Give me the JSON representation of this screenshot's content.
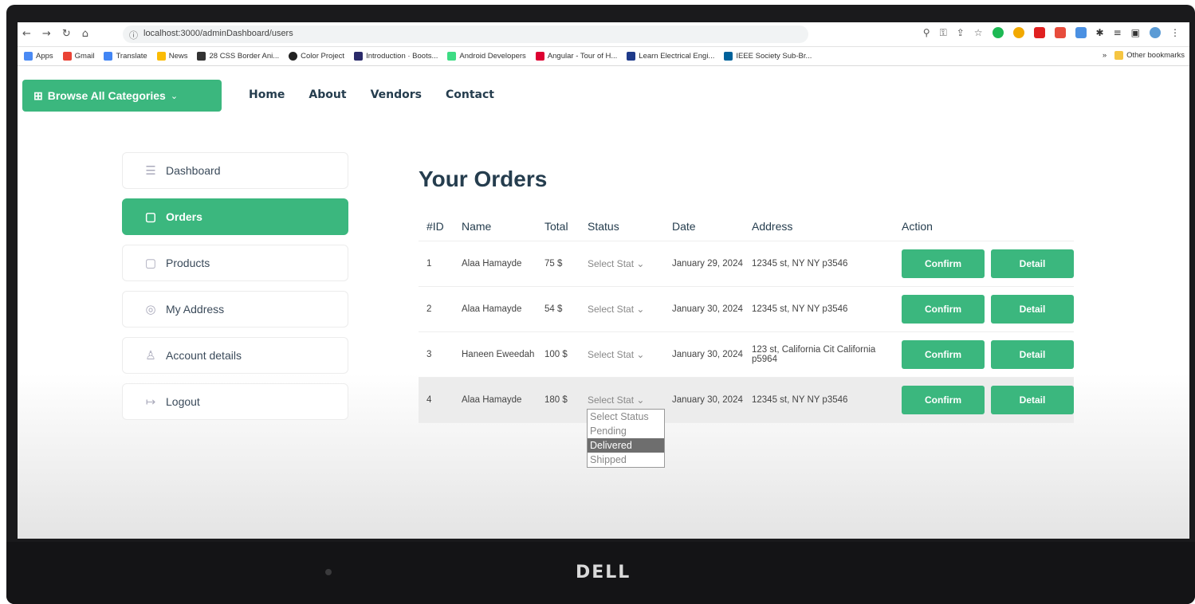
{
  "browser": {
    "url": "localhost:3000/adminDashboard/users",
    "bookmarks": [
      "Apps",
      "Gmail",
      "Translate",
      "News",
      "28 CSS Border Ani...",
      "Color Project",
      "Introduction · Boots...",
      "Android Developers",
      "Angular - Tour of H...",
      "Learn Electrical Engi...",
      "IEEE Society Sub-Br..."
    ],
    "other_bookmarks": "Other bookmarks",
    "overflow": "»"
  },
  "header": {
    "browse_label": "Browse All Categories",
    "nav": [
      "Home",
      "About",
      "Vendors",
      "Contact"
    ]
  },
  "sidebar": {
    "items": [
      {
        "label": "Dashboard",
        "icon": "sliders-icon"
      },
      {
        "label": "Orders",
        "icon": "bag-icon"
      },
      {
        "label": "Products",
        "icon": "bag-icon"
      },
      {
        "label": "My Address",
        "icon": "location-pin-icon"
      },
      {
        "label": "Account details",
        "icon": "user-icon"
      },
      {
        "label": "Logout",
        "icon": "logout-icon"
      }
    ]
  },
  "orders": {
    "title": "Your Orders",
    "columns": [
      "#ID",
      "Name",
      "Total",
      "Status",
      "Date",
      "Address",
      "Action"
    ],
    "rows": [
      {
        "id": "1",
        "name": "Alaa Hamayde",
        "total": "75 $",
        "status": "Select Stat",
        "date": "January 29, 2024",
        "address": "12345 st, NY NY p3546"
      },
      {
        "id": "2",
        "name": "Alaa Hamayde",
        "total": "54 $",
        "status": "Select Stat",
        "date": "January 30, 2024",
        "address": "12345 st, NY NY p3546"
      },
      {
        "id": "3",
        "name": "Haneen Eweedah",
        "total": "100 $",
        "status": "Select Stat",
        "date": "January 30, 2024",
        "address": "123 st, California Cit California p5964"
      },
      {
        "id": "4",
        "name": "Alaa Hamayde",
        "total": "180 $",
        "status": "Select Stat",
        "date": "January 30, 2024",
        "address": "12345 st, NY NY p3546"
      }
    ],
    "confirm_label": "Confirm",
    "detail_label": "Detail"
  },
  "status_dropdown": {
    "options": [
      "Select Status",
      "Pending",
      "Delivered",
      "Shipped"
    ],
    "highlighted": "Delivered"
  },
  "monitor_brand": "DELL",
  "colors": {
    "accent": "#3bb77e",
    "heading": "#253d4e"
  }
}
